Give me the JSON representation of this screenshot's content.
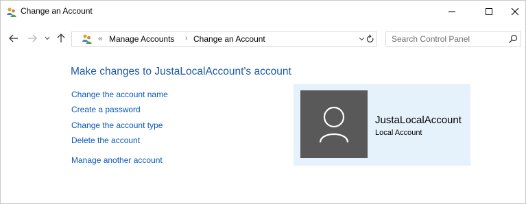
{
  "window": {
    "title": "Change an Account",
    "minimize_glyph": "—",
    "maximize_glyph": "☐",
    "close_glyph": "✕"
  },
  "navigation": {
    "back_icon": "arrow-left-icon",
    "forward_icon": "arrow-right-icon",
    "recent_icon": "chevron-down-icon",
    "up_icon": "arrow-up-icon"
  },
  "address": {
    "overflow_chevron": "«",
    "crumbs": [
      "Manage Accounts",
      "Change an Account"
    ],
    "separator": "›"
  },
  "search": {
    "placeholder": "Search Control Panel"
  },
  "content": {
    "heading": "Make changes to JustaLocalAccount's account",
    "links": [
      "Change the account name",
      "Create a password",
      "Change the account type",
      "Delete the account",
      "Manage another account"
    ]
  },
  "account": {
    "name": "JustaLocalAccount",
    "type": "Local Account"
  },
  "colors": {
    "heading": "#1e5aa6",
    "link": "#0a59b8",
    "panel_bg": "#e5f1fb",
    "avatar_bg": "#595959"
  }
}
